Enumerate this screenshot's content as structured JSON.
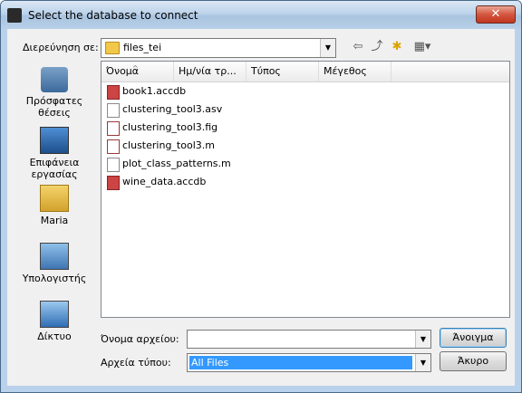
{
  "window": {
    "title": "Select the database to connect",
    "close_label": "✕"
  },
  "lookin": {
    "label": "Διερεύνηση σε:",
    "value": "files_tei",
    "arrow": "▼"
  },
  "toolbar": {
    "back_glyph": "⇦",
    "up_glyph": "⤴",
    "newfolder_glyph": "✱",
    "views_glyph": "▦▾"
  },
  "places": [
    {
      "label": "Πρόσφατες θέσεις",
      "icon": "recent-places-icon"
    },
    {
      "label": "Επιφάνεια εργασίας",
      "icon": "desktop-icon"
    },
    {
      "label": "Maria",
      "icon": "user-folder-icon"
    },
    {
      "label": "Υπολογιστής",
      "icon": "computer-icon"
    },
    {
      "label": "Δίκτυο",
      "icon": "network-icon"
    }
  ],
  "columns": {
    "name": "Όνομα",
    "date": "Ημ/νία τρ...",
    "type": "Τύπος",
    "size": "Μέγεθος",
    "sort_indicator": "^"
  },
  "files": [
    {
      "name": "book1.accdb",
      "kind": "accdb"
    },
    {
      "name": "clustering_tool3.asv",
      "kind": "text"
    },
    {
      "name": "clustering_tool3.fig",
      "kind": "fig"
    },
    {
      "name": "clustering_tool3.m",
      "kind": "fig"
    },
    {
      "name": "plot_class_patterns.m",
      "kind": "text"
    },
    {
      "name": "wine_data.accdb",
      "kind": "accdb"
    }
  ],
  "filename": {
    "label": "Όνομα αρχείου:",
    "value": ""
  },
  "filetype": {
    "label": "Αρχεία τύπου:",
    "value": "All Files"
  },
  "buttons": {
    "open": "Άνοιγμα",
    "cancel": "Άκυρο"
  },
  "colors": {
    "selection": "#3399ff",
    "titlebar": "#bcd3ea",
    "close": "#c0361f"
  }
}
